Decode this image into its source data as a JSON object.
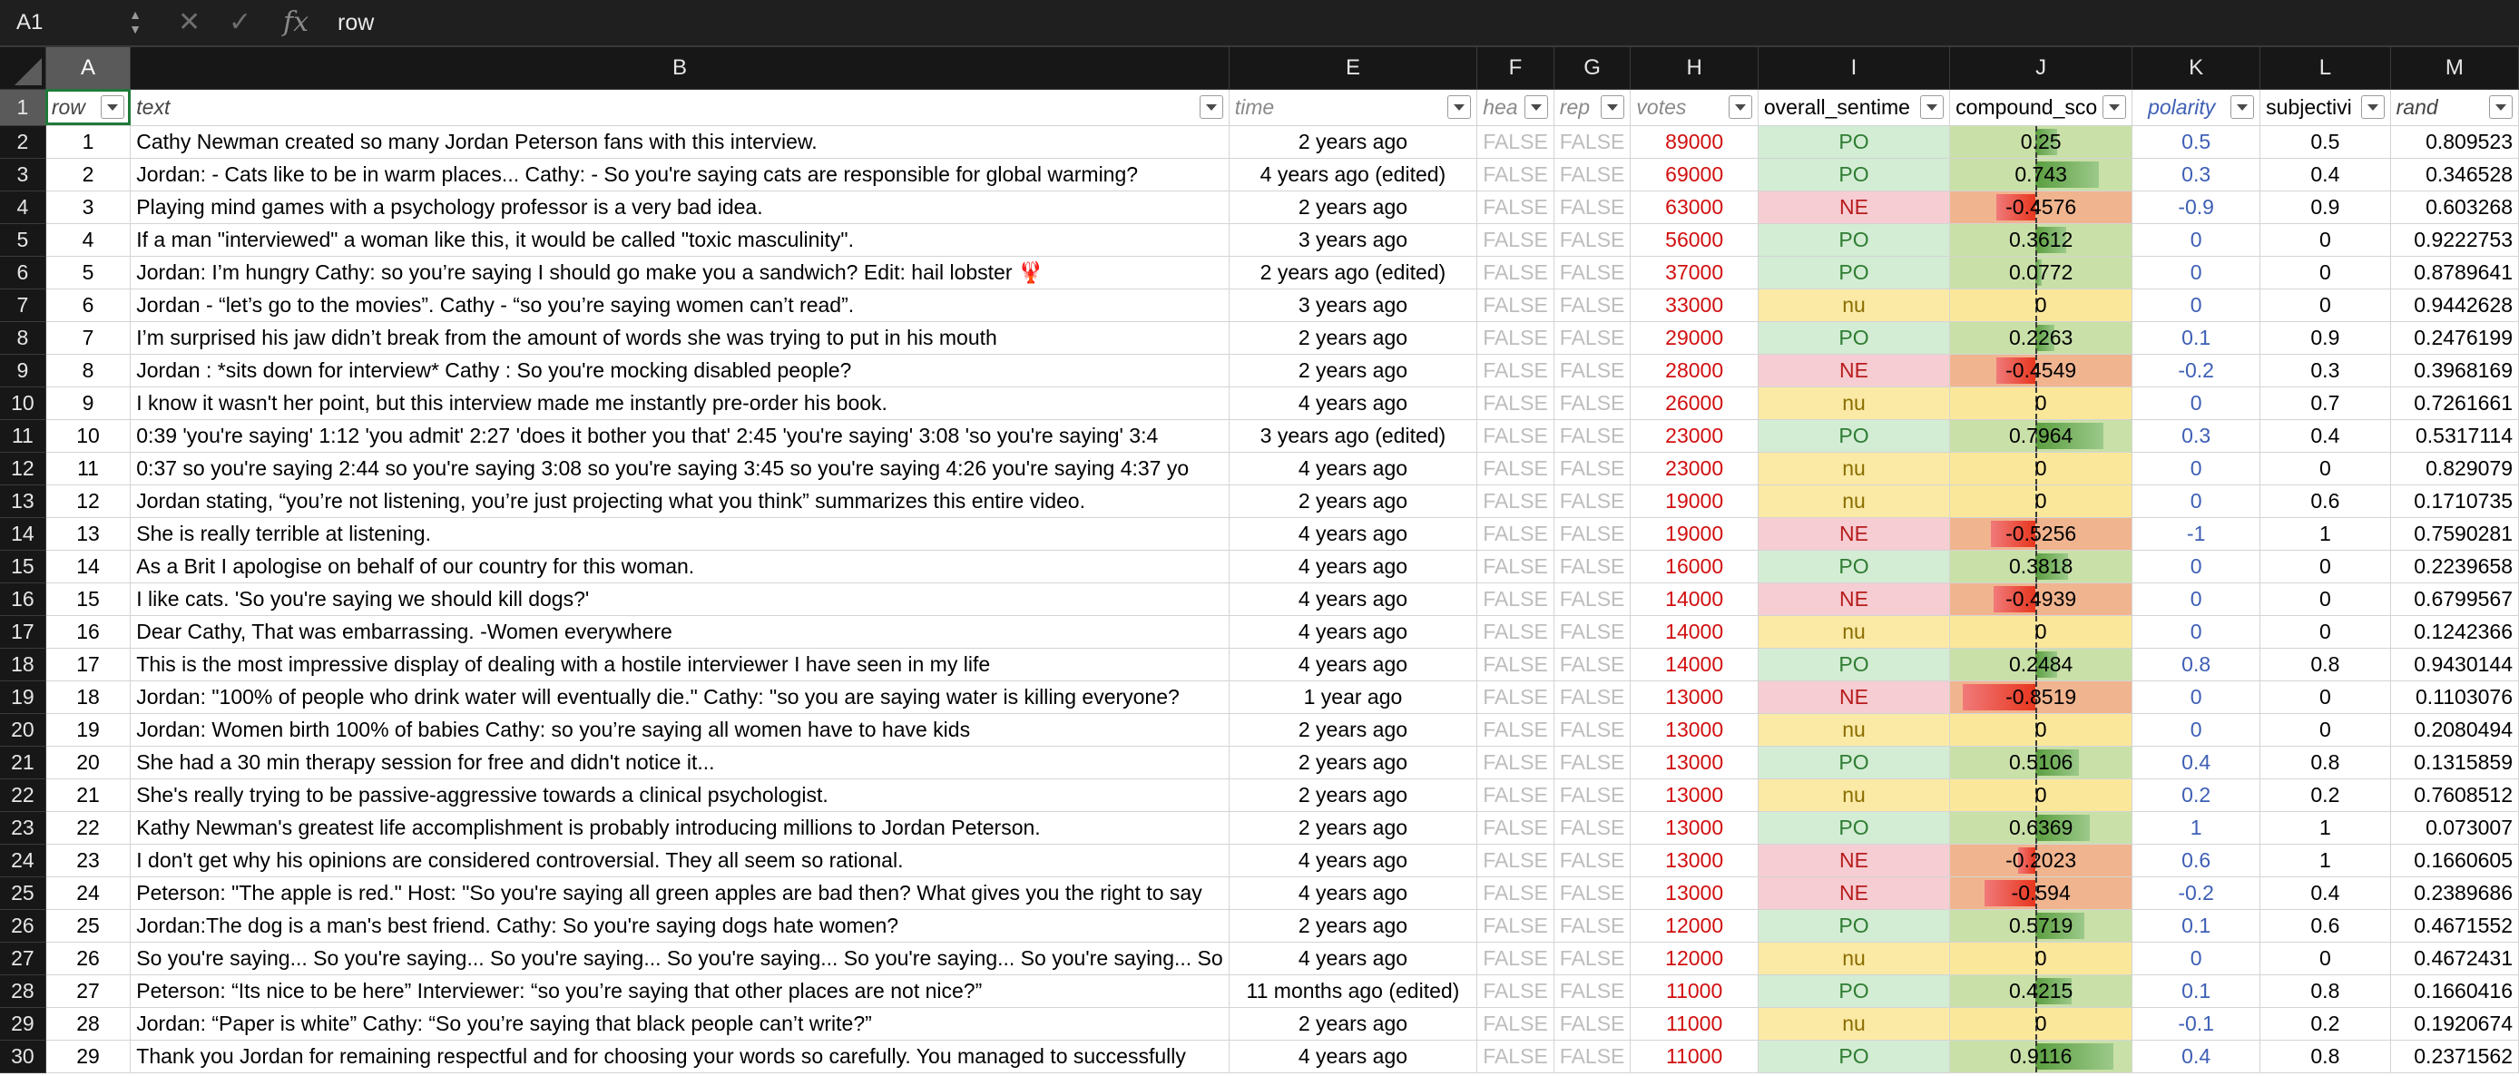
{
  "formula_bar": {
    "cell_ref": "A1",
    "content": "row",
    "cancel_icon": "✕",
    "confirm_icon": "✓",
    "fx_label": "fx"
  },
  "columns": [
    {
      "letter": "A",
      "header": "row"
    },
    {
      "letter": "B",
      "header": "text"
    },
    {
      "letter": "E",
      "header": "time"
    },
    {
      "letter": "F",
      "header": "hea"
    },
    {
      "letter": "G",
      "header": "rep"
    },
    {
      "letter": "H",
      "header": "votes"
    },
    {
      "letter": "I",
      "header": "overall_sentime"
    },
    {
      "letter": "J",
      "header": "compound_sco"
    },
    {
      "letter": "K",
      "header": "polarity"
    },
    {
      "letter": "L",
      "header": "subjectivi"
    },
    {
      "letter": "M",
      "header": "rand"
    }
  ],
  "header_row_number": "1",
  "rows": [
    {
      "n": "2",
      "row": "1",
      "text": "Cathy Newman created so many Jordan Peterson fans with this interview.",
      "time": "2 years ago",
      "hea": "FALSE",
      "rep": "FALSE",
      "votes": "89000",
      "sent": "PO",
      "comp": "0.25",
      "compound": 0.25,
      "polarity": "0.5",
      "subj": "0.5",
      "rand": "0.809523"
    },
    {
      "n": "3",
      "row": "2",
      "text": "Jordan: - Cats like to be in warm places... Cathy: - So you're saying cats are responsible for global warming?",
      "time": "4 years ago (edited)",
      "hea": "FALSE",
      "rep": "FALSE",
      "votes": "69000",
      "sent": "PO",
      "comp": "0.743",
      "compound": 0.743,
      "polarity": "0.3",
      "subj": "0.4",
      "rand": "0.346528"
    },
    {
      "n": "4",
      "row": "3",
      "text": "Playing mind games with a psychology professor is a very bad idea.",
      "time": "2 years ago",
      "hea": "FALSE",
      "rep": "FALSE",
      "votes": "63000",
      "sent": "NE",
      "comp": "-0.4576",
      "compound": -0.4576,
      "polarity": "-0.9",
      "subj": "0.9",
      "rand": "0.603268"
    },
    {
      "n": "5",
      "row": "4",
      "text": "If a man \"interviewed\" a woman like this, it would be called \"toxic masculinity\".",
      "time": "3 years ago",
      "hea": "FALSE",
      "rep": "FALSE",
      "votes": "56000",
      "sent": "PO",
      "comp": "0.3612",
      "compound": 0.3612,
      "polarity": "0",
      "subj": "0",
      "rand": "0.9222753"
    },
    {
      "n": "6",
      "row": "5",
      "text": "Jordan: I’m hungry  Cathy: so you’re saying I should go make you a sandwich?  Edit: hail lobster 🦞",
      "time": "2 years ago (edited)",
      "hea": "FALSE",
      "rep": "FALSE",
      "votes": "37000",
      "sent": "PO",
      "comp": "0.0772",
      "compound": 0.0772,
      "polarity": "0",
      "subj": "0",
      "rand": "0.8789641"
    },
    {
      "n": "7",
      "row": "6",
      "text": "Jordan - “let’s go to the movies”.  Cathy - “so you’re saying women can’t read”.",
      "time": "3 years ago",
      "hea": "FALSE",
      "rep": "FALSE",
      "votes": "33000",
      "sent": "nu",
      "comp": "0",
      "compound": 0,
      "polarity": "0",
      "subj": "0",
      "rand": "0.9442628"
    },
    {
      "n": "8",
      "row": "7",
      "text": "I’m surprised his jaw didn’t break from the amount of words she was trying to put in his mouth",
      "time": "2 years ago",
      "hea": "FALSE",
      "rep": "FALSE",
      "votes": "29000",
      "sent": "PO",
      "comp": "0.2263",
      "compound": 0.2263,
      "polarity": "0.1",
      "subj": "0.9",
      "rand": "0.2476199"
    },
    {
      "n": "9",
      "row": "8",
      "text": "Jordan : *sits down for interview* Cathy : So you're mocking disabled people?",
      "time": "2 years ago",
      "hea": "FALSE",
      "rep": "FALSE",
      "votes": "28000",
      "sent": "NE",
      "comp": "-0.4549",
      "compound": -0.4549,
      "polarity": "-0.2",
      "subj": "0.3",
      "rand": "0.3968169"
    },
    {
      "n": "10",
      "row": "9",
      "text": "I know it wasn't her point, but this interview made me instantly pre-order his book.",
      "time": "4 years ago",
      "hea": "FALSE",
      "rep": "FALSE",
      "votes": "26000",
      "sent": "nu",
      "comp": "0",
      "compound": 0,
      "polarity": "0",
      "subj": "0.7",
      "rand": "0.7261661"
    },
    {
      "n": "11",
      "row": "10",
      "text": "0:39 'you're saying' 1:12 'you admit' 2:27 'does it bother you that' 2:45 'you're saying' 3:08 'so you're saying' 3:4",
      "time": "3 years ago (edited)",
      "hea": "FALSE",
      "rep": "FALSE",
      "votes": "23000",
      "sent": "PO",
      "comp": "0.7964",
      "compound": 0.7964,
      "polarity": "0.3",
      "subj": "0.4",
      "rand": "0.5317114"
    },
    {
      "n": "12",
      "row": "11",
      "text": "0:37 so you're saying 2:44 so you're saying 3:08 so you're saying 3:45 so you're saying 4:26 you're saying 4:37 yo",
      "time": "4 years ago",
      "hea": "FALSE",
      "rep": "FALSE",
      "votes": "23000",
      "sent": "nu",
      "comp": "0",
      "compound": 0,
      "polarity": "0",
      "subj": "0",
      "rand": "0.829079"
    },
    {
      "n": "13",
      "row": "12",
      "text": "Jordan stating, “you’re not listening, you’re just projecting what you think” summarizes this entire video.",
      "time": "2 years ago",
      "hea": "FALSE",
      "rep": "FALSE",
      "votes": "19000",
      "sent": "nu",
      "comp": "0",
      "compound": 0,
      "polarity": "0",
      "subj": "0.6",
      "rand": "0.1710735"
    },
    {
      "n": "14",
      "row": "13",
      "text": "She is really terrible at listening.",
      "time": "4 years ago",
      "hea": "FALSE",
      "rep": "FALSE",
      "votes": "19000",
      "sent": "NE",
      "comp": "-0.5256",
      "compound": -0.5256,
      "polarity": "-1",
      "subj": "1",
      "rand": "0.7590281"
    },
    {
      "n": "15",
      "row": "14",
      "text": "As a Brit I apologise on behalf of our country for this woman.",
      "time": "4 years ago",
      "hea": "FALSE",
      "rep": "FALSE",
      "votes": "16000",
      "sent": "PO",
      "comp": "0.3818",
      "compound": 0.3818,
      "polarity": "0",
      "subj": "0",
      "rand": "0.2239658"
    },
    {
      "n": "16",
      "row": "15",
      "text": "I like cats. 'So you're saying we should kill dogs?'",
      "time": "4 years ago",
      "hea": "FALSE",
      "rep": "FALSE",
      "votes": "14000",
      "sent": "NE",
      "comp": "-0.4939",
      "compound": -0.4939,
      "polarity": "0",
      "subj": "0",
      "rand": "0.6799567"
    },
    {
      "n": "17",
      "row": "16",
      "text": "Dear Cathy,  That was embarrassing.  -Women everywhere",
      "time": "4 years ago",
      "hea": "FALSE",
      "rep": "FALSE",
      "votes": "14000",
      "sent": "nu",
      "comp": "0",
      "compound": 0,
      "polarity": "0",
      "subj": "0",
      "rand": "0.1242366"
    },
    {
      "n": "18",
      "row": "17",
      "text": "This is the most impressive display of dealing with a hostile interviewer I have seen in my life",
      "time": "4 years ago",
      "hea": "FALSE",
      "rep": "FALSE",
      "votes": "14000",
      "sent": "PO",
      "comp": "0.2484",
      "compound": 0.2484,
      "polarity": "0.8",
      "subj": "0.8",
      "rand": "0.9430144"
    },
    {
      "n": "19",
      "row": "18",
      "text": "Jordan: \"100% of people who drink water will eventually die.\"  Cathy: \"so you are saying water is killing everyone?",
      "time": "1 year ago",
      "hea": "FALSE",
      "rep": "FALSE",
      "votes": "13000",
      "sent": "NE",
      "comp": "-0.8519",
      "compound": -0.8519,
      "polarity": "0",
      "subj": "0",
      "rand": "0.1103076"
    },
    {
      "n": "20",
      "row": "19",
      "text": "Jordan: Women birth 100% of babies  Cathy: so you’re saying all women have to have kids",
      "time": "2 years ago",
      "hea": "FALSE",
      "rep": "FALSE",
      "votes": "13000",
      "sent": "nu",
      "comp": "0",
      "compound": 0,
      "polarity": "0",
      "subj": "0",
      "rand": "0.2080494"
    },
    {
      "n": "21",
      "row": "20",
      "text": "She had a 30 min therapy session for free and didn't notice it...",
      "time": "2 years ago",
      "hea": "FALSE",
      "rep": "FALSE",
      "votes": "13000",
      "sent": "PO",
      "comp": "0.5106",
      "compound": 0.5106,
      "polarity": "0.4",
      "subj": "0.8",
      "rand": "0.1315859"
    },
    {
      "n": "22",
      "row": "21",
      "text": "She's really trying to be passive-aggressive towards a clinical psychologist.",
      "time": "2 years ago",
      "hea": "FALSE",
      "rep": "FALSE",
      "votes": "13000",
      "sent": "nu",
      "comp": "0",
      "compound": 0,
      "polarity": "0.2",
      "subj": "0.2",
      "rand": "0.7608512"
    },
    {
      "n": "23",
      "row": "22",
      "text": "Kathy Newman's greatest life accomplishment is probably introducing millions to Jordan Peterson.",
      "time": "2 years ago",
      "hea": "FALSE",
      "rep": "FALSE",
      "votes": "13000",
      "sent": "PO",
      "comp": "0.6369",
      "compound": 0.6369,
      "polarity": "1",
      "subj": "1",
      "rand": "0.073007"
    },
    {
      "n": "24",
      "row": "23",
      "text": "I don't get why his opinions are considered controversial. They all seem so rational.",
      "time": "4 years ago",
      "hea": "FALSE",
      "rep": "FALSE",
      "votes": "13000",
      "sent": "NE",
      "comp": "-0.2023",
      "compound": -0.2023,
      "polarity": "0.6",
      "subj": "1",
      "rand": "0.1660605"
    },
    {
      "n": "25",
      "row": "24",
      "text": "Peterson: \"The apple is red.\" Host: \"So you're saying all green apples are bad then? What gives you the right to say",
      "time": "4 years ago",
      "hea": "FALSE",
      "rep": "FALSE",
      "votes": "13000",
      "sent": "NE",
      "comp": "-0.594",
      "compound": -0.594,
      "polarity": "-0.2",
      "subj": "0.4",
      "rand": "0.2389686"
    },
    {
      "n": "26",
      "row": "25",
      "text": "Jordan:The dog is a man's best friend. Cathy: So you're saying dogs hate women?",
      "time": "2 years ago",
      "hea": "FALSE",
      "rep": "FALSE",
      "votes": "12000",
      "sent": "PO",
      "comp": "0.5719",
      "compound": 0.5719,
      "polarity": "0.1",
      "subj": "0.6",
      "rand": "0.4671552"
    },
    {
      "n": "27",
      "row": "26",
      "text": "So you're saying... So you're saying... So you're saying... So you're saying... So you're saying... So you're saying... So",
      "time": "4 years ago",
      "hea": "FALSE",
      "rep": "FALSE",
      "votes": "12000",
      "sent": "nu",
      "comp": "0",
      "compound": 0,
      "polarity": "0",
      "subj": "0",
      "rand": "0.4672431"
    },
    {
      "n": "28",
      "row": "27",
      "text": "Peterson: “Its nice to be here” Interviewer: “so you’re saying that other places are not nice?”",
      "time": "11 months ago (edited)",
      "hea": "FALSE",
      "rep": "FALSE",
      "votes": "11000",
      "sent": "PO",
      "comp": "0.4215",
      "compound": 0.4215,
      "polarity": "0.1",
      "subj": "0.8",
      "rand": "0.1660416"
    },
    {
      "n": "29",
      "row": "28",
      "text": "Jordan: “Paper is white”  Cathy: “So you’re saying that black people can’t write?”",
      "time": "2 years ago",
      "hea": "FALSE",
      "rep": "FALSE",
      "votes": "11000",
      "sent": "nu",
      "comp": "0",
      "compound": 0,
      "polarity": "-0.1",
      "subj": "0.2",
      "rand": "0.1920674"
    },
    {
      "n": "30",
      "row": "29",
      "text": "Thank you Jordan for remaining respectful and for choosing your words so carefully. You managed to successfully",
      "time": "4 years ago",
      "hea": "FALSE",
      "rep": "FALSE",
      "votes": "11000",
      "sent": "PO",
      "comp": "0.9116",
      "compound": 0.9116,
      "polarity": "0.4",
      "subj": "0.8",
      "rand": "0.2371562"
    }
  ]
}
